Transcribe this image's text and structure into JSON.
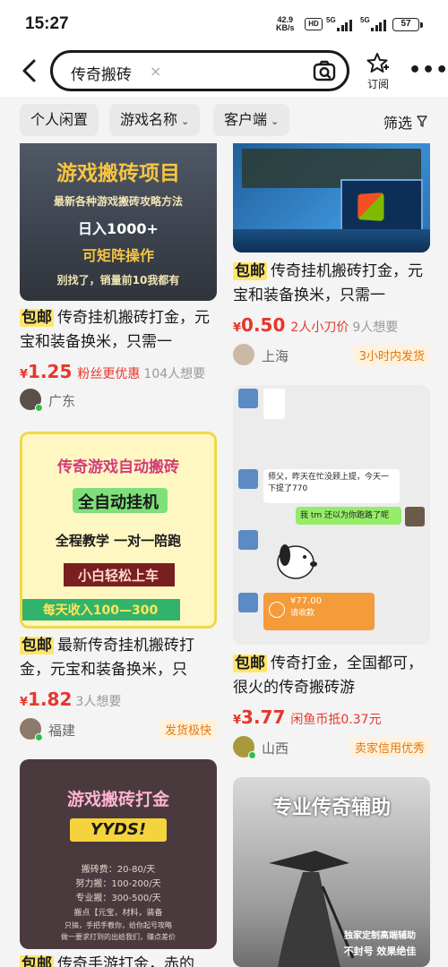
{
  "status": {
    "time": "15:27",
    "net_speed": "42.9",
    "net_unit": "KB/s",
    "hd": "HD",
    "sig1": "5G",
    "sig2": "5G",
    "battery": "57"
  },
  "header": {
    "query": "传奇搬砖",
    "clear": "×",
    "subscribe_label": "订阅",
    "more": "•••"
  },
  "filters": {
    "items": [
      "个人闲置",
      "游戏名称",
      "客户端"
    ],
    "sort_label": "筛选"
  },
  "cards": [
    {
      "img_lines": [
        "游戏搬砖项目",
        "最新各种游戏搬砖攻略方法",
        "日入1000+",
        "可矩阵操作",
        "别找了，销量前10我都有"
      ],
      "tag": "包邮",
      "title": "传奇挂机搬砖打金，元宝和装备换米，只需一",
      "price": "1.25",
      "promo": "粉丝更优惠",
      "wants": "104人想要",
      "location": "广东",
      "badge": ""
    },
    {
      "tag": "包邮",
      "title": "传奇挂机搬砖打金，元宝和装备换米，只需一",
      "price": "0.50",
      "promo": "2人小刀价",
      "wants": "9人想要",
      "location": "上海",
      "badge": "3小时内发货"
    },
    {
      "img_lines": [
        "传奇游戏自动搬砖",
        "全自动挂机",
        "全程教学 一对一陪跑",
        "小白轻松上车",
        "每天收入100—300"
      ],
      "tag": "包邮",
      "title": "最新传奇挂机搬砖打金，元宝和装备换米，只",
      "price": "1.82",
      "promo": "",
      "wants": "3人想要",
      "location": "福建",
      "badge": "发货极快"
    },
    {
      "chat": {
        "msg1": "师父，昨天在忙没顾上提，今天一下提了770",
        "msg2": "我 tm 还以为你跑路了呢",
        "amount": "¥77.00",
        "pay_hint": "请收款"
      },
      "tag": "包邮",
      "title": "传奇打金，全国都可，很火的传奇搬砖游",
      "price": "3.77",
      "promo": "闲鱼币抵0.37元",
      "wants": "",
      "location": "山西",
      "badge": "卖家信用优秀"
    },
    {
      "img_lines": [
        "游戏搬砖打金",
        "YYDS!",
        "搬砖费：20-80/天",
        "努力搬：100-200/天",
        "专业搬：300-500/天",
        "搬点【元宝，材料，装备",
        "只搞，手把手教你，给你起号攻略",
        "做一要求打到的出给我们，赚点差价"
      ],
      "tag": "包邮",
      "title": "传奇手游打金，赤的"
    },
    {
      "img_lines": [
        "专业传奇辅助",
        "独家定制高端辅助",
        "不封号 效果绝佳"
      ]
    }
  ]
}
